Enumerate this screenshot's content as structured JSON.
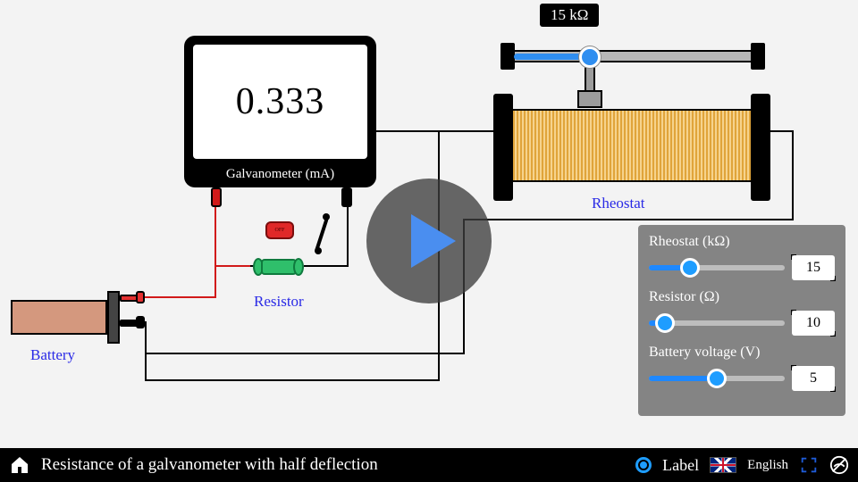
{
  "galvanometer": {
    "value": "0.333",
    "label": "Galvanometer (mA)"
  },
  "battery": {
    "label": "Battery"
  },
  "resistor": {
    "label": "Resistor",
    "switch_text": "OFF"
  },
  "rheostat": {
    "label": "Rheostat",
    "value_display": "15 kΩ"
  },
  "panel": {
    "rheostat": {
      "label": "Rheostat (kΩ)",
      "value": "15",
      "min": 0,
      "max": 50,
      "pct": 30
    },
    "resistor": {
      "label": "Resistor (Ω)",
      "value": "10",
      "min": 0,
      "max": 100,
      "pct": 12
    },
    "voltage": {
      "label": "Battery voltage (V)",
      "value": "5",
      "min": 0,
      "max": 10,
      "pct": 50
    }
  },
  "footer": {
    "title": "Resistance of a galvanometer with half deflection",
    "label_toggle": "Label",
    "language": "English"
  }
}
